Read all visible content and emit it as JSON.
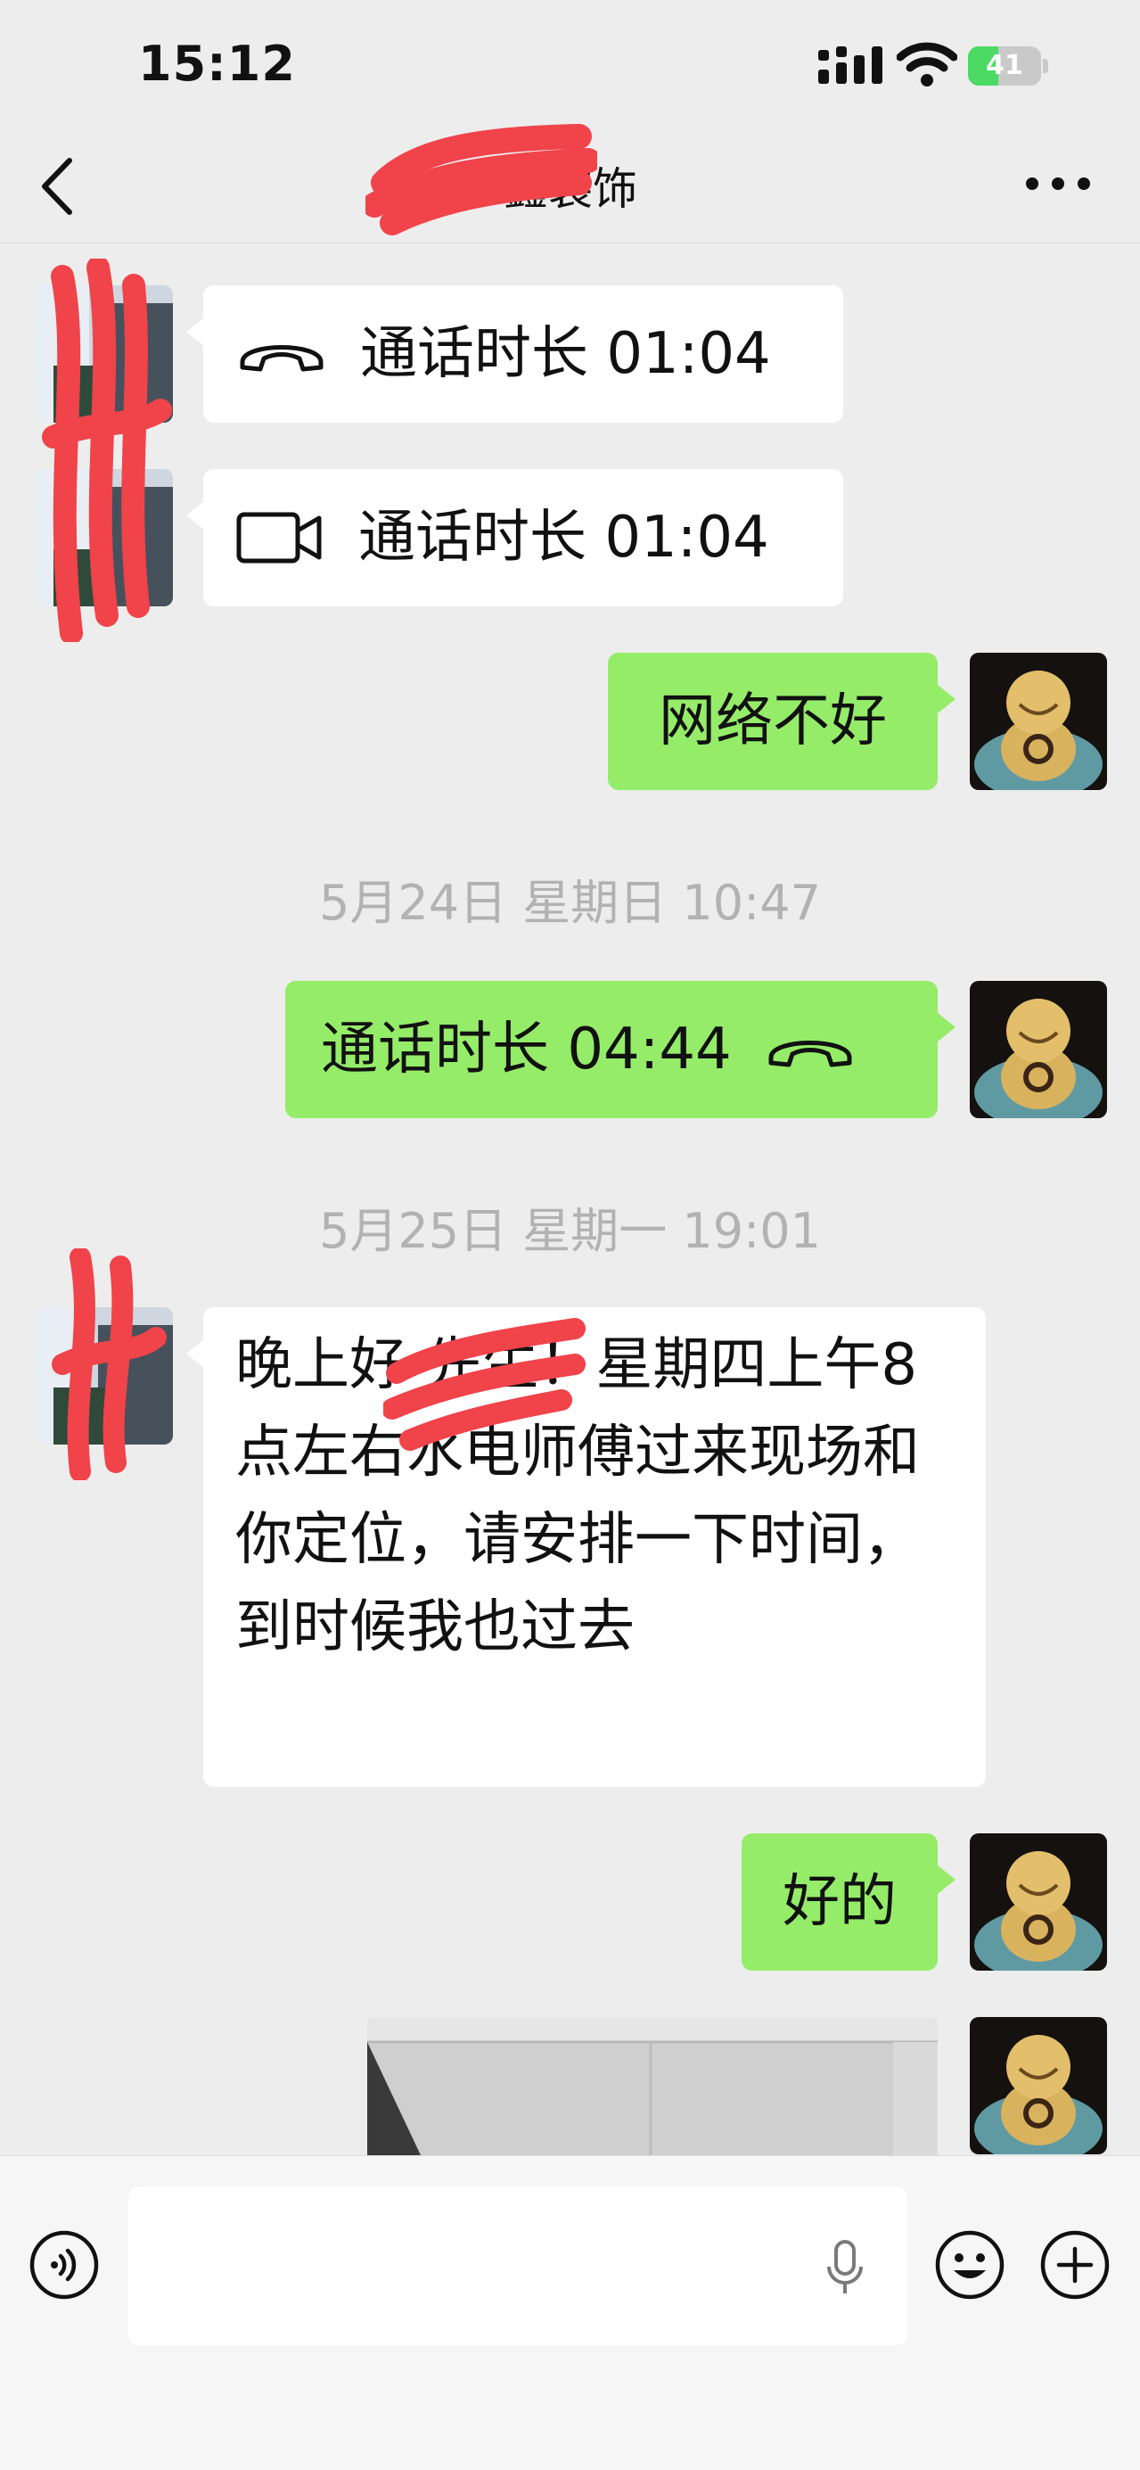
{
  "status_bar": {
    "time": "15:12",
    "battery": "41",
    "battery_level": 0.41
  },
  "header": {
    "title": "鑫装饰"
  },
  "messages": {
    "call1": "通话时长 01:04",
    "call2": "通话时长 01:04",
    "m_network": "网络不好",
    "ts1": "5月24日 星期日 10:47",
    "call3": "通话时长 04:44",
    "ts2": "5月25日 星期一 19:01",
    "long_msg": "晚上好 先生！星期四上午8点左右水电师傅过来现场和你定位，请安排一下时间，到时候我也过去",
    "m_ok": "好的"
  },
  "colors": {
    "sent_bubble": "#95ec69",
    "received_bubble": "#ffffff",
    "background": "#ededed",
    "redaction": "#f0434a"
  },
  "icons": [
    "back-icon",
    "more-icon",
    "phone-icon",
    "video-icon",
    "voice-icon",
    "mic-icon",
    "emoji-icon",
    "plus-icon"
  ]
}
